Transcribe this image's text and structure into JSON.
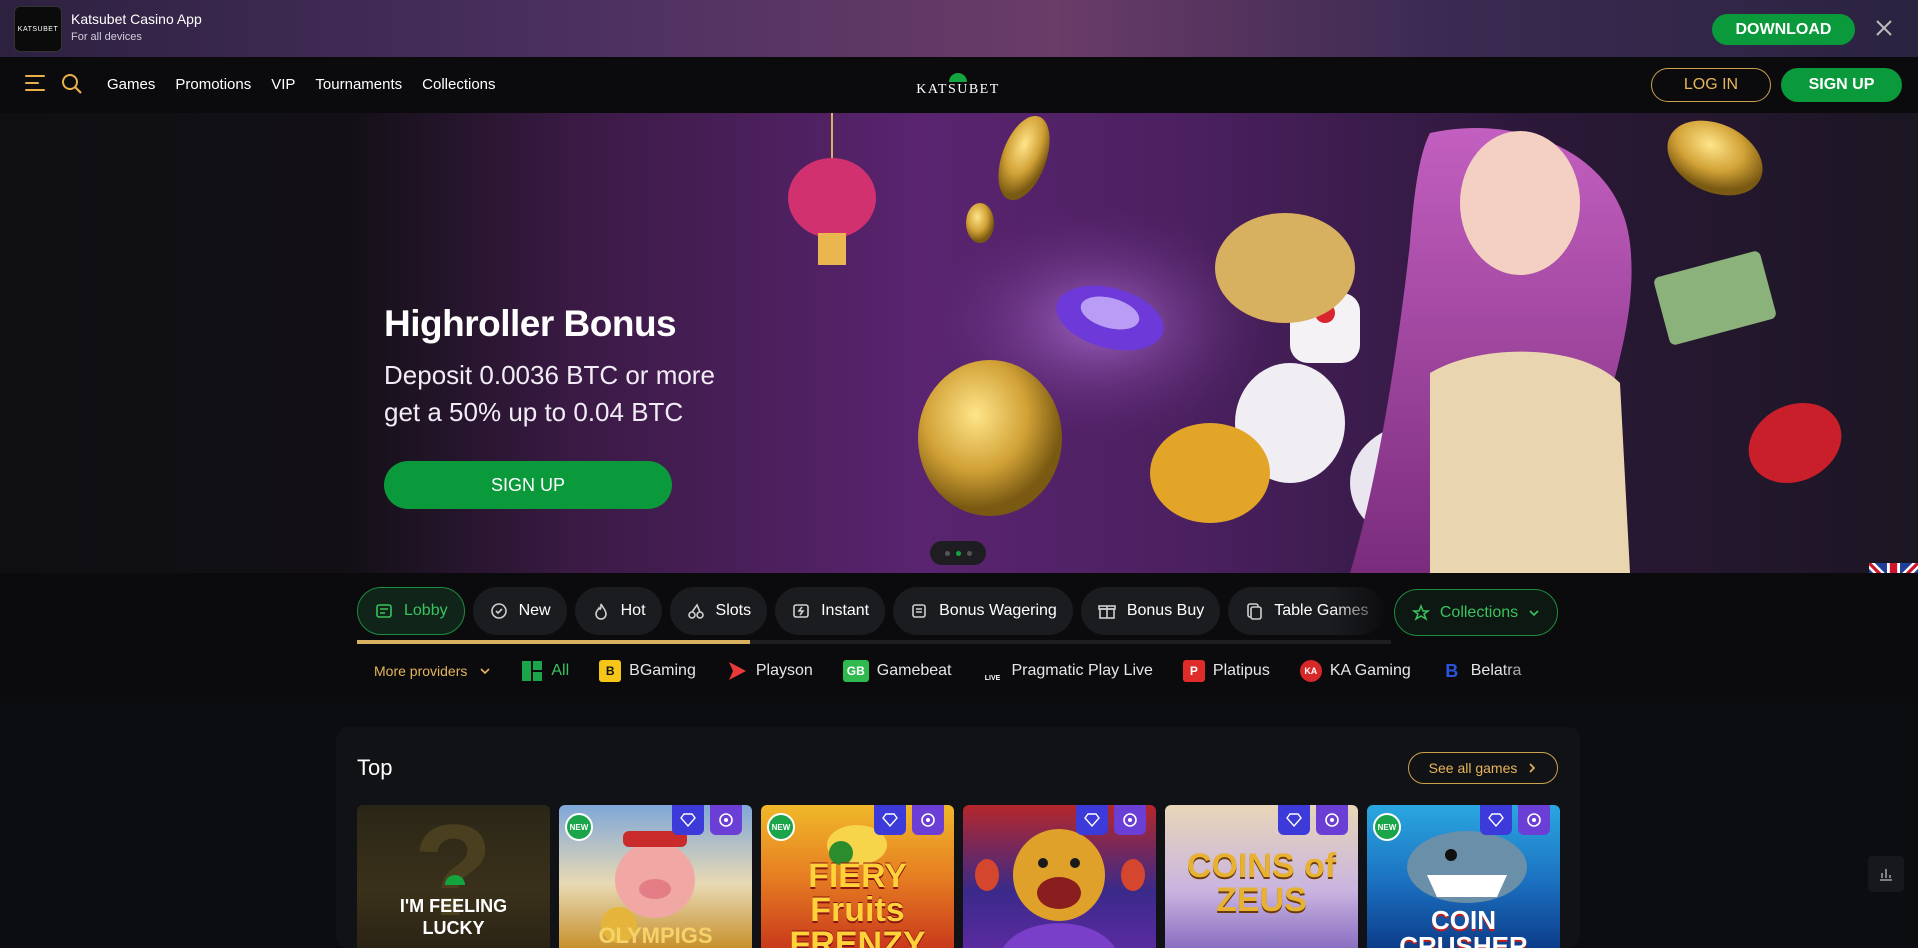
{
  "app_banner": {
    "logo_text": "KATSUBET",
    "title": "Katsubet Casino App",
    "subtitle": "For all devices",
    "download_label": "DOWNLOAD",
    "close_icon": "close-icon"
  },
  "nav": {
    "links": [
      "Games",
      "Promotions",
      "VIP",
      "Tournaments",
      "Collections"
    ],
    "brand": "KATSUBET",
    "login_label": "LOG IN",
    "signup_label": "SIGN UP",
    "menu_icon": "hamburger-icon",
    "search_icon": "search-icon"
  },
  "hero": {
    "title": "Highroller Bonus",
    "line1": "Deposit 0.0036 BTC or more",
    "line2": "get a 50% up to 0.04 BTC",
    "cta_label": "SIGN UP",
    "slides": 3,
    "active_slide": 2,
    "language_icon": "uk-flag-icon"
  },
  "categories": {
    "items": [
      {
        "label": "Lobby",
        "icon": "lobby-icon",
        "active": true
      },
      {
        "label": "New",
        "icon": "new-icon",
        "active": false
      },
      {
        "label": "Hot",
        "icon": "fire-icon",
        "active": false
      },
      {
        "label": "Slots",
        "icon": "cherry-icon",
        "active": false
      },
      {
        "label": "Instant",
        "icon": "instant-icon",
        "active": false
      },
      {
        "label": "Bonus Wagering",
        "icon": "wager-icon",
        "active": false
      },
      {
        "label": "Bonus Buy",
        "icon": "gift-icon",
        "active": false
      },
      {
        "label": "Table Games",
        "icon": "cards-icon",
        "active": false
      }
    ],
    "collections_label": "Collections",
    "scroll_fraction": 0.38
  },
  "providers": {
    "more_label": "More providers",
    "items": [
      {
        "label": "All",
        "logo": "all-grid-icon",
        "color": "#1aa54a",
        "active": true
      },
      {
        "label": "BGaming",
        "logo": "B",
        "color": "#f5c518",
        "active": false
      },
      {
        "label": "Playson",
        "logo": "playson-icon",
        "color": "#e83a3a",
        "active": false
      },
      {
        "label": "Gamebeat",
        "logo": "GB",
        "color": "#2fb94f",
        "active": false
      },
      {
        "label": "Pragmatic Play Live",
        "logo": "LIVE",
        "color": "#ffffff",
        "active": false
      },
      {
        "label": "Platipus",
        "logo": "P",
        "color": "#e02b2b",
        "active": false
      },
      {
        "label": "KA Gaming",
        "logo": "KA",
        "color": "#d62828",
        "active": false
      },
      {
        "label": "Belatra",
        "logo": "B",
        "color": "#2a55e0",
        "active": false
      }
    ]
  },
  "top": {
    "title": "Top",
    "see_all_label": "See all games",
    "lucky_label_1": "I'M FEELING",
    "lucky_label_2": "LUCKY",
    "games": [
      {
        "name": "lucky",
        "new": false
      },
      {
        "name": "Olympigs",
        "text": "OLYMPIGS",
        "new": true,
        "new_label": "NEW"
      },
      {
        "name": "Fiery Fruits Frenzy",
        "text": "FIERY Fruits FRENZY",
        "new": true,
        "new_label": "NEW"
      },
      {
        "name": "Tiger game",
        "text": "",
        "new": false
      },
      {
        "name": "Coins of Zeus",
        "text": "COINS of ZEUS",
        "new": false
      },
      {
        "name": "Coin Crusher",
        "text": "COIN CRUSHER",
        "new": true,
        "new_label": "NEW"
      }
    ]
  },
  "colors": {
    "accent_green": "#0a9a3c",
    "accent_gold": "#e6b55b",
    "background": "#0c0d10"
  }
}
